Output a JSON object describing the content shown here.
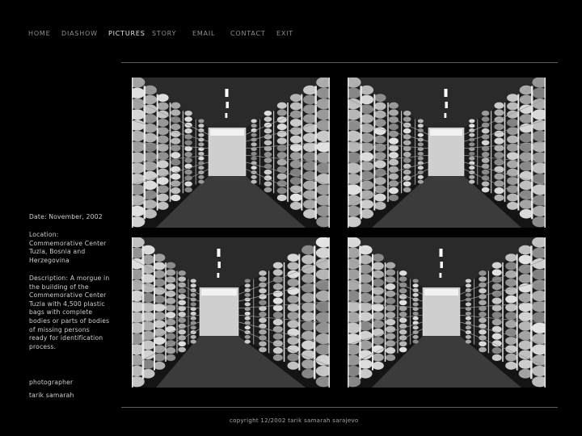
{
  "nav": {
    "items": [
      {
        "label": "HOME"
      },
      {
        "label": "DIASHOW"
      },
      {
        "label": "PICTURES",
        "active": true
      },
      {
        "label": "STORY"
      },
      {
        "label": "EMAIL"
      },
      {
        "label": "CONTACT"
      },
      {
        "label": "EXIT"
      }
    ]
  },
  "photo": {
    "date": "Date: November, 2002",
    "location_label": "Location:",
    "location": "Commemorative Center Tuzla, Bosnia and Herzegovina",
    "description_label": "Description:",
    "description": "A morgue in the building of the Commemorative Center Tuzla with 4,500 plastic bags with complete bodies or parts of bodies of missing persons ready for identification process.",
    "photographer_label": "photographer",
    "photographer": "tarik samarah"
  },
  "footer": {
    "copyright": "copyright 12/2002 tarik samarah sarajevo"
  },
  "colors": {
    "background": "#000000",
    "text": "#c8c8c8",
    "nav_inactive": "#8e8e8e",
    "rule": "#5a5a5a"
  }
}
